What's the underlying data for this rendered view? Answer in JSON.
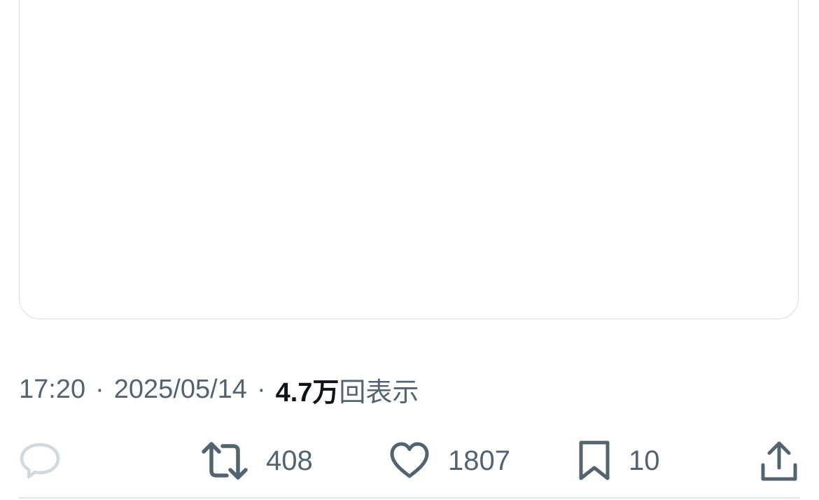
{
  "tweet": {
    "time": "17:20",
    "separator": "·",
    "date": "2025/05/14",
    "views_count": "4.7万",
    "views_label": "回表示"
  },
  "actions": {
    "reply": {
      "icon": "reply-icon",
      "count": ""
    },
    "retweet": {
      "icon": "retweet-icon",
      "count": "408"
    },
    "like": {
      "icon": "heart-icon",
      "count": "1807"
    },
    "bookmark": {
      "icon": "bookmark-icon",
      "count": "10"
    },
    "share": {
      "icon": "share-icon"
    }
  },
  "colors": {
    "secondary_text": "#536471",
    "primary_text": "#0f1419",
    "reply_icon_disabled": "#cfd9de",
    "border": "#d9dde1"
  }
}
